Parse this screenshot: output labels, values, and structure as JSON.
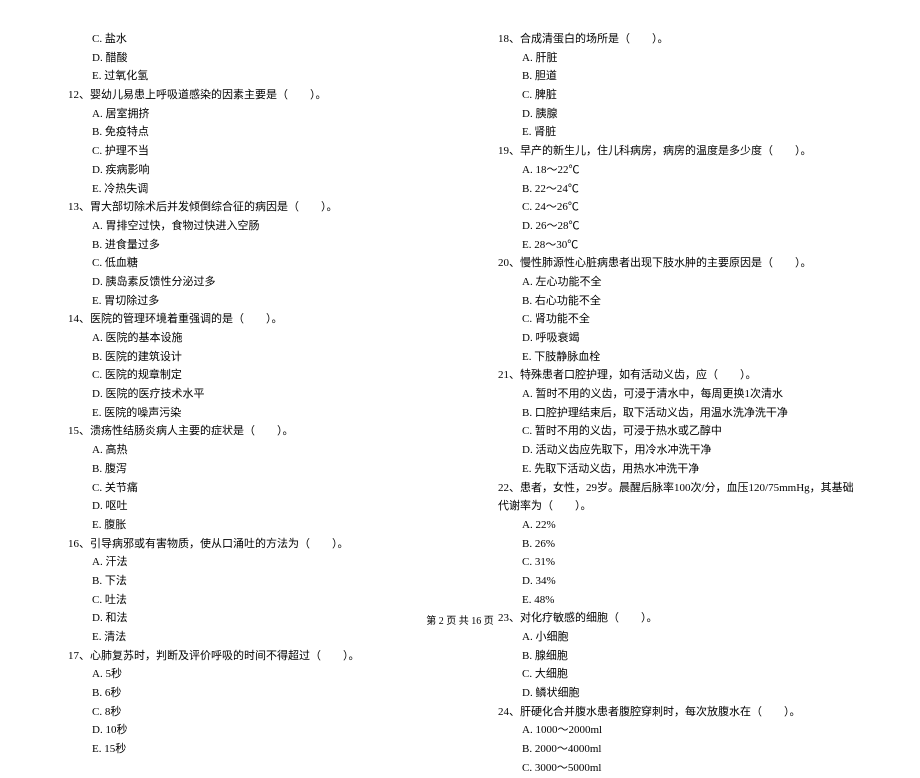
{
  "left": {
    "q11": {
      "optC": "C. 盐水",
      "optD": "D. 醋酸",
      "optE": "E. 过氧化氢"
    },
    "q12": {
      "num": "12、",
      "text": "婴幼儿易患上呼吸道感染的因素主要是（　　）。",
      "optA": "A. 居室拥挤",
      "optB": "B. 免疫特点",
      "optC": "C. 护理不当",
      "optD": "D. 疾病影响",
      "optE": "E. 冷热失调"
    },
    "q13": {
      "num": "13、",
      "text": "胃大部切除术后并发倾倒综合征的病因是（　　）。",
      "optA": "A. 胃排空过快，食物过快进入空肠",
      "optB": "B. 进食量过多",
      "optC": "C. 低血糖",
      "optD": "D. 胰岛素反馈性分泌过多",
      "optE": "E. 胃切除过多"
    },
    "q14": {
      "num": "14、",
      "text": "医院的管理环境着重强调的是（　　）。",
      "optA": "A. 医院的基本设施",
      "optB": "B. 医院的建筑设计",
      "optC": "C. 医院的规章制定",
      "optD": "D. 医院的医疗技术水平",
      "optE": "E. 医院的噪声污染"
    },
    "q15": {
      "num": "15、",
      "text": "溃疡性结肠炎病人主要的症状是（　　）。",
      "optA": "A. 高热",
      "optB": "B. 腹泻",
      "optC": "C. 关节痛",
      "optD": "D. 呕吐",
      "optE": "E. 腹胀"
    },
    "q16": {
      "num": "16、",
      "text": "引导病邪或有害物质，使从口涌吐的方法为（　　）。",
      "optA": "A. 汗法",
      "optB": "B. 下法",
      "optC": "C. 吐法",
      "optD": "D. 和法",
      "optE": "E. 清法"
    },
    "q17": {
      "num": "17、",
      "text": "心肺复苏时，判断及评价呼吸的时间不得超过（　　）。",
      "optA": "A. 5秒",
      "optB": "B. 6秒",
      "optC": "C. 8秒",
      "optD": "D. 10秒",
      "optE": "E. 15秒"
    }
  },
  "right": {
    "q18": {
      "num": "18、",
      "text": "合成清蛋白的场所是（　　）。",
      "optA": "A. 肝脏",
      "optB": "B. 胆道",
      "optC": "C. 脾脏",
      "optD": "D. 胰腺",
      "optE": "E. 肾脏"
    },
    "q19": {
      "num": "19、",
      "text": "早产的新生儿，住儿科病房，病房的温度是多少度（　　）。",
      "optA": "A. 18～22℃",
      "optB": "B. 22～24℃",
      "optC": "C. 24～26℃",
      "optD": "D. 26～28℃",
      "optE": "E. 28～30℃"
    },
    "q20": {
      "num": "20、",
      "text": "慢性肺源性心脏病患者出现下肢水肿的主要原因是（　　）。",
      "optA": "A. 左心功能不全",
      "optB": "B. 右心功能不全",
      "optC": "C. 肾功能不全",
      "optD": "D. 呼吸衰竭",
      "optE": "E. 下肢静脉血栓"
    },
    "q21": {
      "num": "21、",
      "text": "特殊患者口腔护理，如有活动义齿，应（　　）。",
      "optA": "A. 暂时不用的义齿，可浸于清水中，每周更换1次清水",
      "optB": "B. 口腔护理结束后，取下活动义齿，用温水洗净洗干净",
      "optC": "C. 暂时不用的义齿，可浸于热水或乙醇中",
      "optD": "D. 活动义齿应先取下，用冷水冲洗干净",
      "optE": "E. 先取下活动义齿，用热水冲洗干净"
    },
    "q22": {
      "num": "22、",
      "text": "患者，女性，29岁。晨醒后脉率100次/分，血压120/75mmHg，其基础代谢率为（　　）。",
      "optA": "A. 22%",
      "optB": "B. 26%",
      "optC": "C. 31%",
      "optD": "D. 34%",
      "optE": "E. 48%"
    },
    "q23": {
      "num": "23、",
      "text": "对化疗敏感的细胞（　　）。",
      "optA": "A. 小细胞",
      "optB": "B. 腺细胞",
      "optC": "C. 大细胞",
      "optD": "D. 鳞状细胞"
    },
    "q24": {
      "num": "24、",
      "text": "肝硬化合并腹水患者腹腔穿刺时，每次放腹水在（　　）。",
      "optA": "A. 1000～2000ml",
      "optB": "B. 2000～4000ml",
      "optC": "C. 3000～5000ml"
    }
  },
  "footer": "第 2 页 共 16 页"
}
